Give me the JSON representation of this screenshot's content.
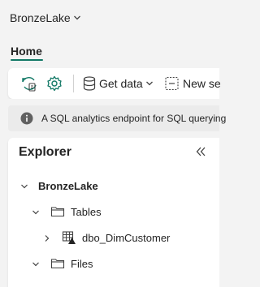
{
  "app": {
    "title": "BronzeLake"
  },
  "tabs": [
    {
      "label": "Home",
      "selected": true
    }
  ],
  "toolbar": {
    "get_data_label": "Get data",
    "new_label": "New se"
  },
  "banner": {
    "text": "A SQL analytics endpoint for SQL querying"
  },
  "explorer": {
    "title": "Explorer",
    "tree": {
      "root": "BronzeLake",
      "tables": "Tables",
      "table_item": "dbo_DimCustomer",
      "files": "Files"
    }
  },
  "colors": {
    "accent": "#117865",
    "info": "#616161"
  }
}
